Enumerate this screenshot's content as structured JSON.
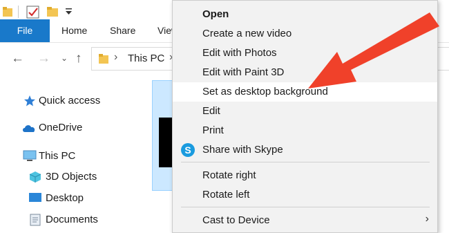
{
  "ribbon": {
    "tabs": [
      "File",
      "Home",
      "Share",
      "View"
    ]
  },
  "address_bar": {
    "location": "This PC"
  },
  "sidebar": {
    "items": [
      {
        "label": "Quick access",
        "icon": "star-icon"
      },
      {
        "label": "OneDrive",
        "icon": "cloud-icon"
      },
      {
        "label": "This PC",
        "icon": "computer-icon"
      },
      {
        "label": "3D Objects",
        "icon": "cube-icon"
      },
      {
        "label": "Desktop",
        "icon": "desktop-icon"
      },
      {
        "label": "Documents",
        "icon": "document-icon"
      }
    ]
  },
  "context_menu": {
    "items": [
      {
        "label": "Open",
        "bold": true
      },
      {
        "label": "Create a new video"
      },
      {
        "label": "Edit with Photos"
      },
      {
        "label": "Edit with Paint 3D"
      },
      {
        "label": "Set as desktop background",
        "highlighted": true
      },
      {
        "label": "Edit"
      },
      {
        "label": "Print"
      },
      {
        "label": "Share with Skype",
        "icon": "skype-icon"
      },
      {
        "label": "Rotate right"
      },
      {
        "label": "Rotate left"
      },
      {
        "label": "Cast to Device",
        "has_submenu": true
      }
    ]
  },
  "colors": {
    "accent": "#1979ca",
    "highlight": "#ffffff",
    "annotation_arrow": "#f0412a",
    "menu_bg": "#f2f2f2"
  },
  "icons": {
    "skype_letter": "S"
  }
}
